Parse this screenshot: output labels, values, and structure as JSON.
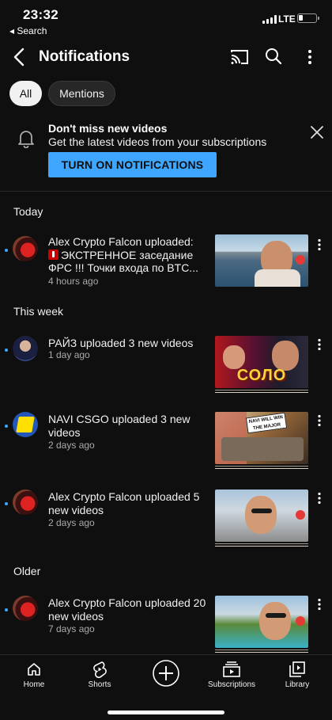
{
  "status_bar": {
    "time": "23:32",
    "back_app": "◂ Search",
    "network": "LTE"
  },
  "header": {
    "title": "Notifications"
  },
  "chips": [
    {
      "label": "All"
    },
    {
      "label": "Mentions"
    }
  ],
  "promo": {
    "title": "Don't miss new videos",
    "subtitle": "Get the latest videos from your subscriptions",
    "button": "TURN ON NOTIFICATIONS"
  },
  "sections": {
    "today": "Today",
    "this_week": "This week",
    "older": "Older"
  },
  "notifications": [
    {
      "text_pre": "Alex Crypto Falcon uploaded: ",
      "text_post": "ЭКСТРЕННОЕ заседание ФРС !!! Точки входа по BTC...",
      "time": "4 hours ago"
    },
    {
      "text": "РАЙЗ uploaded 3 new videos",
      "time": "1 day ago",
      "thumb_caption": "СОЛО"
    },
    {
      "text": "NAVI CSGO uploaded 3 new videos",
      "time": "2 days ago",
      "thumb_caption": "NAVI WILL WIN THE MAJOR"
    },
    {
      "text": "Alex Crypto Falcon uploaded 5 new videos",
      "time": "2 days ago"
    },
    {
      "text": "Alex Crypto Falcon uploaded 20 new videos",
      "time": "7 days ago"
    }
  ],
  "bottom_nav": [
    {
      "label": "Home",
      "icon": "home-icon"
    },
    {
      "label": "Shorts",
      "icon": "shorts-icon"
    },
    {
      "label": "",
      "icon": "create-icon"
    },
    {
      "label": "Subscriptions",
      "icon": "subscriptions-icon"
    },
    {
      "label": "Library",
      "icon": "library-icon"
    }
  ],
  "colors": {
    "background": "#0f0f0f",
    "accent": "#3ea6ff",
    "chip_active": "#f1f1f1",
    "unread_dot": "#3ea6ff"
  }
}
